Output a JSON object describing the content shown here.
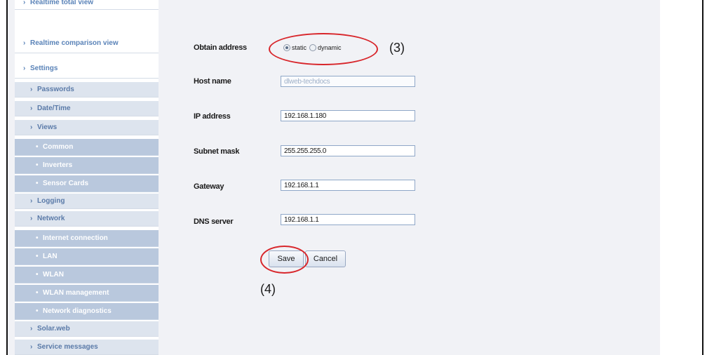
{
  "sidebar": {
    "items": [
      {
        "label": "Realtime total view",
        "level": "top"
      },
      {
        "label": "Realtime comparison view",
        "level": "top"
      },
      {
        "label": "Settings",
        "level": "top"
      },
      {
        "label": "Passwords",
        "level": "l1"
      },
      {
        "label": "Date/Time",
        "level": "l1"
      },
      {
        "label": "Views",
        "level": "l1"
      },
      {
        "label": "Common",
        "level": "l2"
      },
      {
        "label": "Inverters",
        "level": "l2"
      },
      {
        "label": "Sensor Cards",
        "level": "l2"
      },
      {
        "label": "Logging",
        "level": "l1"
      },
      {
        "label": "Network",
        "level": "l1"
      },
      {
        "label": "Internet connection",
        "level": "l2"
      },
      {
        "label": "LAN",
        "level": "l2"
      },
      {
        "label": "WLAN",
        "level": "l2"
      },
      {
        "label": "WLAN management",
        "level": "l2"
      },
      {
        "label": "Network diagnostics",
        "level": "l2"
      },
      {
        "label": "Solar.web",
        "level": "l1"
      },
      {
        "label": "Service messages",
        "level": "l1"
      }
    ]
  },
  "form": {
    "obtain_address_label": "Obtain address",
    "radio_static": "static",
    "radio_dynamic": "dynamic",
    "selected_mode": "static",
    "hostname_label": "Host name",
    "hostname_value": "dlweb-techdocs",
    "ip_label": "IP address",
    "ip_value": "192.168.1.180",
    "subnet_label": "Subnet mask",
    "subnet_value": "255.255.255.0",
    "gateway_label": "Gateway",
    "gateway_value": "192.168.1.1",
    "dns_label": "DNS server",
    "dns_value": "192.168.1.1",
    "save_label": "Save",
    "cancel_label": "Cancel"
  },
  "callouts": {
    "step3": "(3)",
    "step4": "(4)",
    "color": "#d8262b"
  }
}
